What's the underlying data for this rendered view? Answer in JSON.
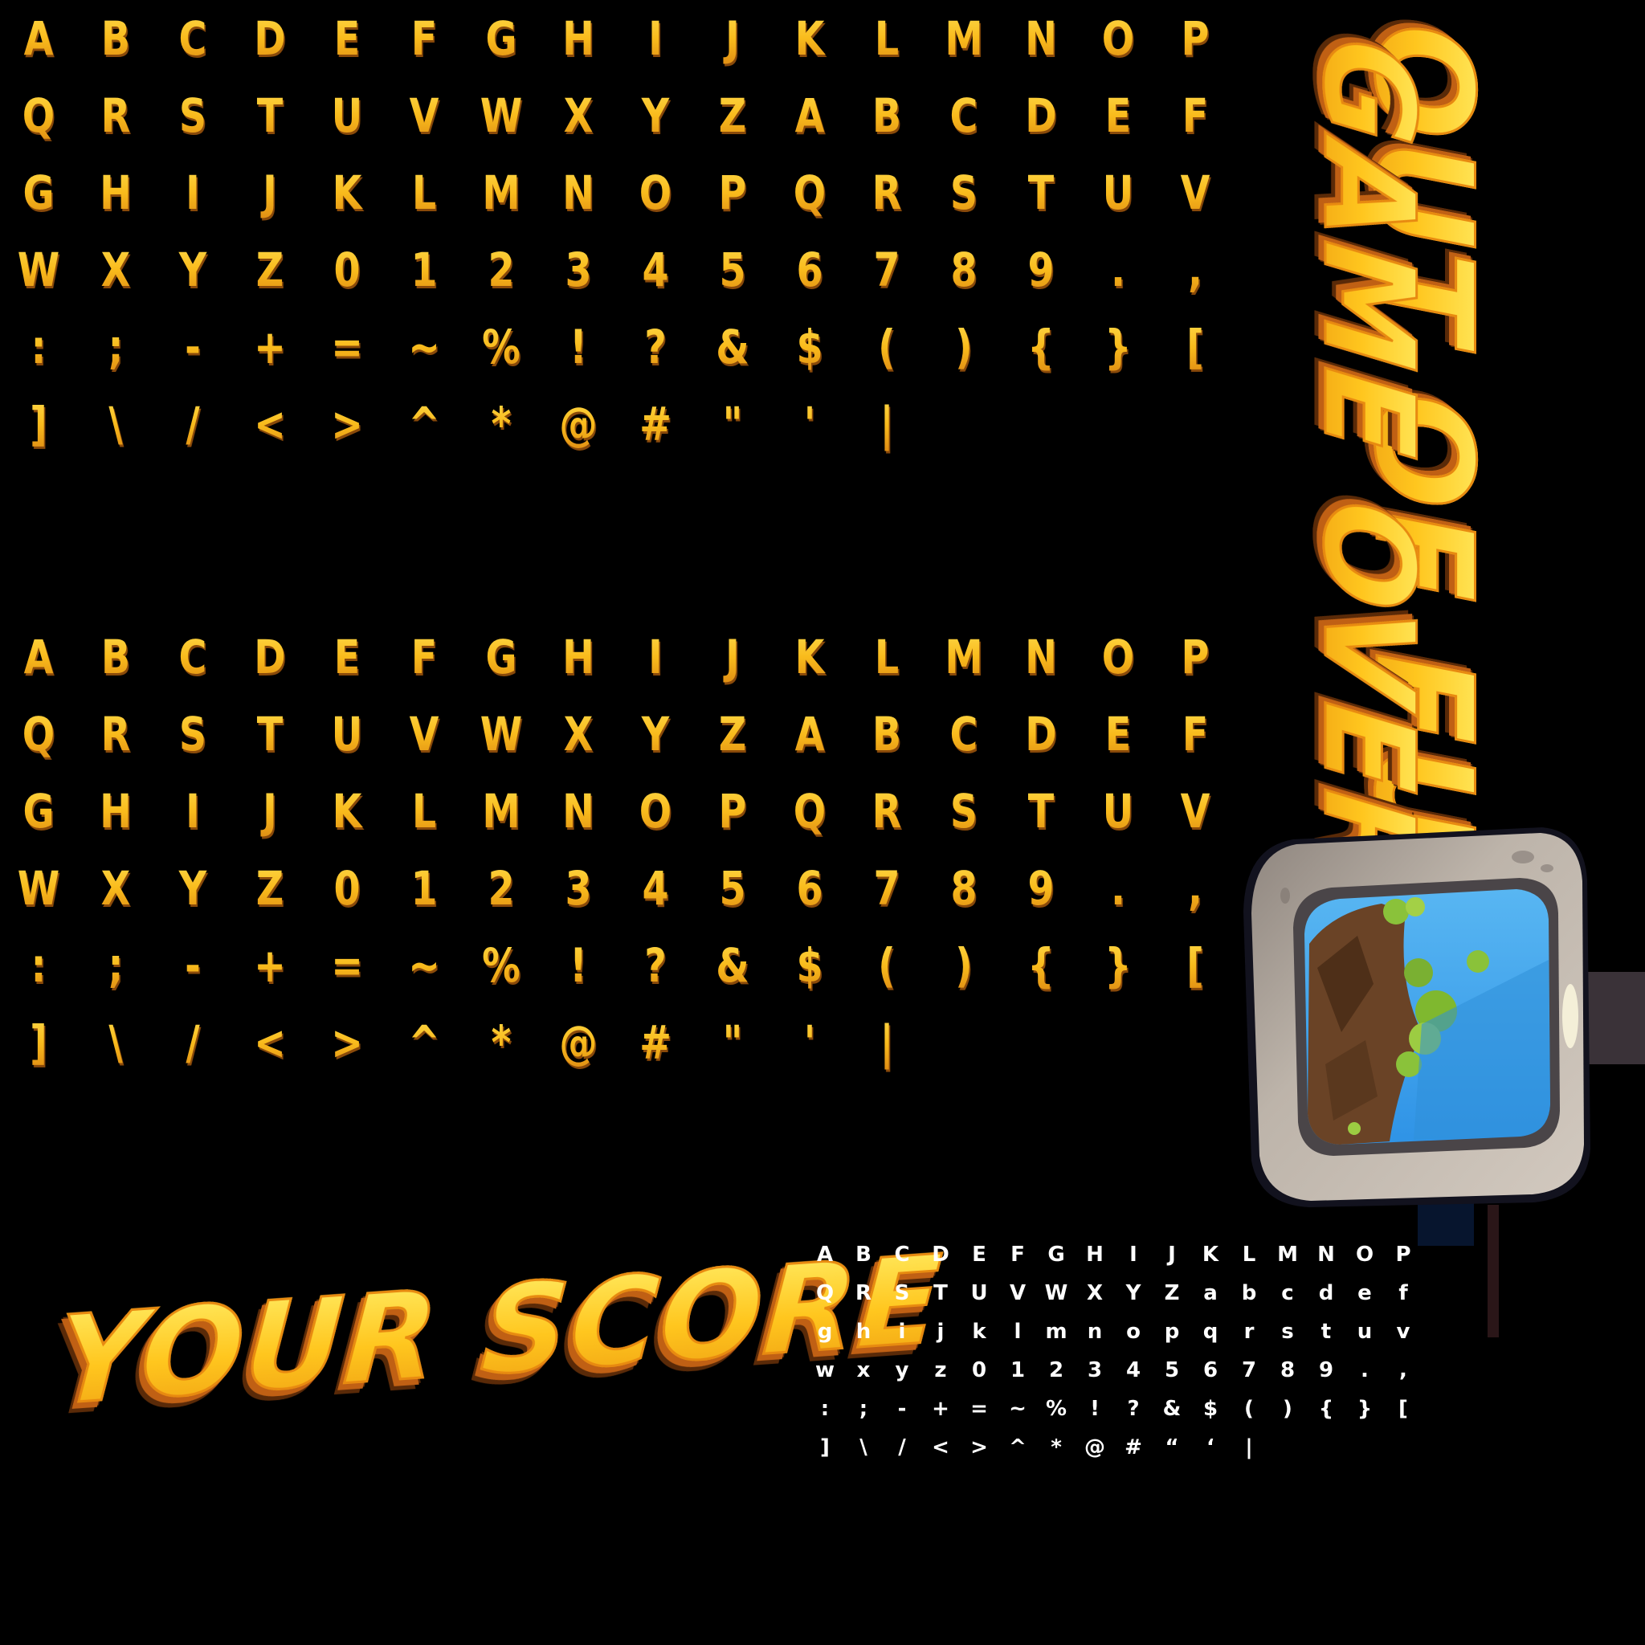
{
  "font_sheet_a": {
    "rows": [
      [
        "A",
        "B",
        "C",
        "D",
        "E",
        "F",
        "G",
        "H",
        "I",
        "J",
        "K",
        "L",
        "M",
        "N",
        "O",
        "P"
      ],
      [
        "Q",
        "R",
        "S",
        "T",
        "U",
        "V",
        "W",
        "X",
        "Y",
        "Z",
        "A",
        "B",
        "C",
        "D",
        "E",
        "F"
      ],
      [
        "G",
        "H",
        "I",
        "J",
        "K",
        "L",
        "M",
        "N",
        "O",
        "P",
        "Q",
        "R",
        "S",
        "T",
        "U",
        "V"
      ],
      [
        "W",
        "X",
        "Y",
        "Z",
        "0",
        "1",
        "2",
        "3",
        "4",
        "5",
        "6",
        "7",
        "8",
        "9",
        ".",
        ","
      ],
      [
        ":",
        ";",
        "-",
        "+",
        "=",
        "~",
        "%",
        "!",
        "?",
        "&",
        "$",
        "(",
        ")",
        "{",
        "}",
        "["
      ],
      [
        "]",
        "\\",
        "/",
        "<",
        ">",
        "^",
        "*",
        "@",
        "#",
        "\"",
        "'",
        "|"
      ]
    ]
  },
  "font_sheet_b": {
    "rows": [
      [
        "A",
        "B",
        "C",
        "D",
        "E",
        "F",
        "G",
        "H",
        "I",
        "J",
        "K",
        "L",
        "M",
        "N",
        "O",
        "P"
      ],
      [
        "Q",
        "R",
        "S",
        "T",
        "U",
        "V",
        "W",
        "X",
        "Y",
        "Z",
        "A",
        "B",
        "C",
        "D",
        "E",
        "F"
      ],
      [
        "G",
        "H",
        "I",
        "J",
        "K",
        "L",
        "M",
        "N",
        "O",
        "P",
        "Q",
        "R",
        "S",
        "T",
        "U",
        "V"
      ],
      [
        "W",
        "X",
        "Y",
        "Z",
        "0",
        "1",
        "2",
        "3",
        "4",
        "5",
        "6",
        "7",
        "8",
        "9",
        ".",
        ","
      ],
      [
        ":",
        ";",
        "-",
        "+",
        "=",
        "~",
        "%",
        "!",
        "?",
        "&",
        "$",
        "(",
        ")",
        "{",
        "}",
        "["
      ],
      [
        "]",
        "\\",
        "/",
        "<",
        ">",
        "^",
        "*",
        "@",
        "#",
        "\"",
        "'",
        "|"
      ]
    ]
  },
  "font_sheet_white": {
    "rows": [
      [
        "A",
        "B",
        "C",
        "D",
        "E",
        "F",
        "G",
        "H",
        "I",
        "J",
        "K",
        "L",
        "M",
        "N",
        "O",
        "P"
      ],
      [
        "Q",
        "R",
        "S",
        "T",
        "U",
        "V",
        "W",
        "X",
        "Y",
        "Z",
        "a",
        "b",
        "c",
        "d",
        "e",
        "f"
      ],
      [
        "g",
        "h",
        "i",
        "j",
        "k",
        "l",
        "m",
        "n",
        "o",
        "p",
        "q",
        "r",
        "s",
        "t",
        "u",
        "v"
      ],
      [
        "w",
        "x",
        "y",
        "z",
        "0",
        "1",
        "2",
        "3",
        "4",
        "5",
        "6",
        "7",
        "8",
        "9",
        ".",
        ","
      ],
      [
        ":",
        ";",
        "-",
        "+",
        "=",
        "~",
        "%",
        "!",
        "?",
        "&",
        "$",
        "(",
        ")",
        "{",
        "}",
        "["
      ],
      [
        "]",
        "\\",
        "/",
        "<",
        ">",
        "^",
        "*",
        "@",
        "#",
        "“",
        "‘",
        "|"
      ]
    ]
  },
  "titles": {
    "out_of_fuel": "OUT OF FUEL",
    "game_over": "GAME OVER",
    "your_score": "YOUR SCORE"
  },
  "colors": {
    "background": "#000000",
    "glyph_gold": "#f9bb1c",
    "glyph_shadow": "#8a4a0a",
    "title_yellow": "#ffd52a",
    "title_orange": "#c06014",
    "window_stone": "#b7aea4",
    "window_sky": "#3aa4ee"
  },
  "sprites": {
    "window": "stone-window-icon"
  }
}
